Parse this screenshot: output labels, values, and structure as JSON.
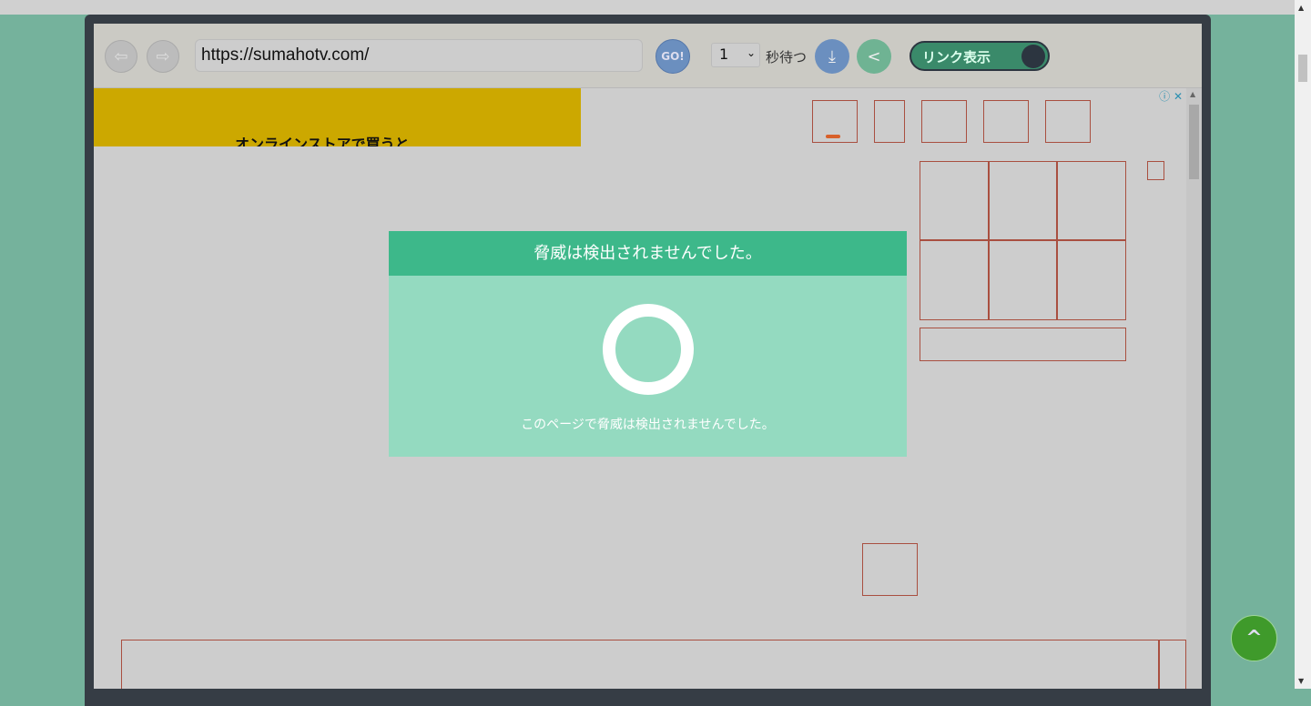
{
  "toolbar": {
    "url": "https://sumahotv.com/",
    "go_label": "GO!",
    "wait_value": "1",
    "wait_label": "秒待つ",
    "toggle_label": "リンク表示"
  },
  "ad": {
    "text": "オンラインストアで買うと…",
    "info_icon": "ⓘ",
    "close_icon": "✕"
  },
  "modal": {
    "title": "脅威は検出されませんでした。",
    "message": "このページで脅威は検出されませんでした。"
  },
  "colors": {
    "background": "#75b29c",
    "modal_header": "#3db88a",
    "modal_body": "#94dac0",
    "toggle": "#3a8a6a",
    "scroll_top": "#3f9a2b"
  }
}
